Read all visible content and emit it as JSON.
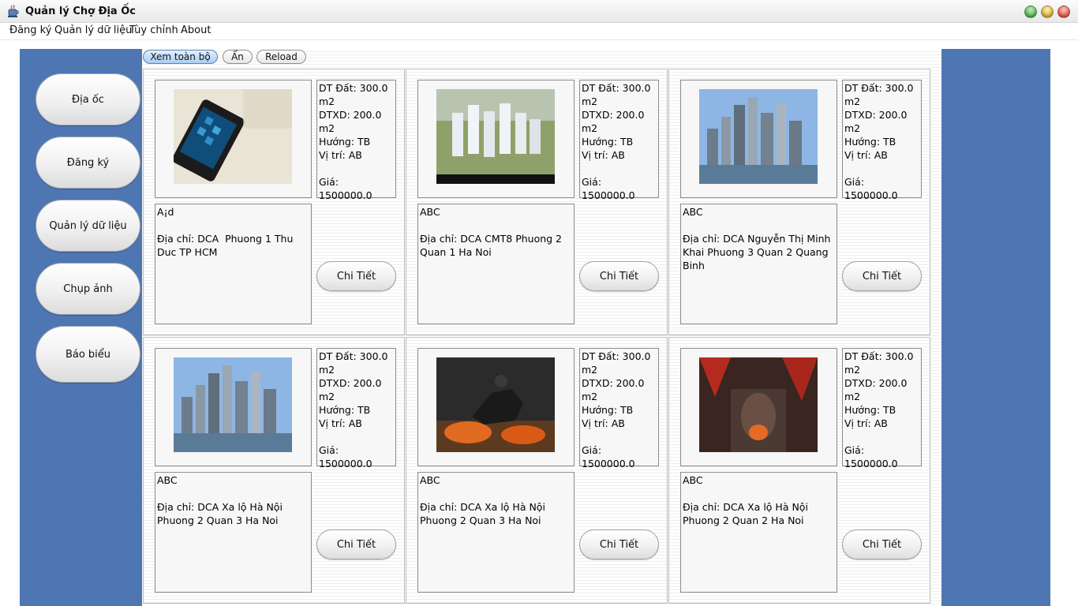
{
  "window": {
    "title": "Quản lý Chợ Địa Ốc",
    "controls": [
      "green-light",
      "yellow-light",
      "red-light"
    ]
  },
  "menu": [
    "Đăng ký",
    "Quản lý dữ liệu",
    "Tùy chỉnh",
    "About"
  ],
  "sidebar": [
    "Địa ốc",
    "Đăng ký",
    "Quản lý dữ liệu",
    "Chụp ảnh",
    "Báo biểu"
  ],
  "toolbar": {
    "view_all": "Xem toàn bộ",
    "hide": "Ẩn",
    "reload": "Reload"
  },
  "colors": {
    "panel": "#4e76b3",
    "active_button": "#a9cdf3"
  },
  "detail_label": "Chi Tiết",
  "listings": [
    {
      "image": "phone-photo",
      "area": "DT Đất: 300.0 m2",
      "built": "DTXD: 200.0 m2",
      "direction": "Hướng: TB",
      "position": "Vị trí: AB",
      "price": "Giá: 1500000.0",
      "name": "A¡d",
      "address": "Địa chỉ: DCA  Phuong 1 Thu Duc TP HCM"
    },
    {
      "image": "apartment-complex-photo",
      "area": "DT Đất: 300.0 m2",
      "built": "DTXD: 200.0 m2",
      "direction": "Hướng: TB",
      "position": "Vị trí: AB",
      "price": "Giá: 1500000.0",
      "name": "ABC",
      "address": "Địa chỉ: DCA CMT8 Phuong 2 Quan 1 Ha Noi"
    },
    {
      "image": "city-skyline-photo",
      "area": "DT Đất: 300.0 m2",
      "built": "DTXD: 200.0 m2",
      "direction": "Hướng: TB",
      "position": "Vị trí: AB",
      "price": "Giá: 1500000.0",
      "name": "ABC",
      "address": "Địa chỉ: DCA Nguyễn Thị Minh Khai Phuong 3 Quan 2 Quang Binh"
    },
    {
      "image": "city-skyline-photo",
      "area": "DT Đất: 300.0 m2",
      "built": "DTXD: 200.0 m2",
      "direction": "Hướng: TB",
      "position": "Vị trí: AB",
      "price": "Giá: 1500000.0",
      "name": "ABC",
      "address": "Địa chỉ: DCA Xa lộ Hà Nội Phuong 2 Quan 3 Ha Noi"
    },
    {
      "image": "fantasy-horse-rider-art",
      "area": "DT Đất: 300.0 m2",
      "built": "DTXD: 200.0 m2",
      "direction": "Hướng: TB",
      "position": "Vị trí: AB",
      "price": "Giá: 1500000.0",
      "name": "ABC",
      "address": "Địa chỉ: DCA Xa lộ Hà Nội Phuong 2 Quan 3 Ha Noi"
    },
    {
      "image": "fantasy-dragon-art",
      "area": "DT Đất: 300.0 m2",
      "built": "DTXD: 200.0 m2",
      "direction": "Hướng: TB",
      "position": "Vị trí: AB",
      "price": "Giá: 1500000.0",
      "name": "ABC",
      "address": "Địa chỉ: DCA Xa lộ Hà Nội Phuong 2 Quan 2 Ha Noi"
    }
  ]
}
